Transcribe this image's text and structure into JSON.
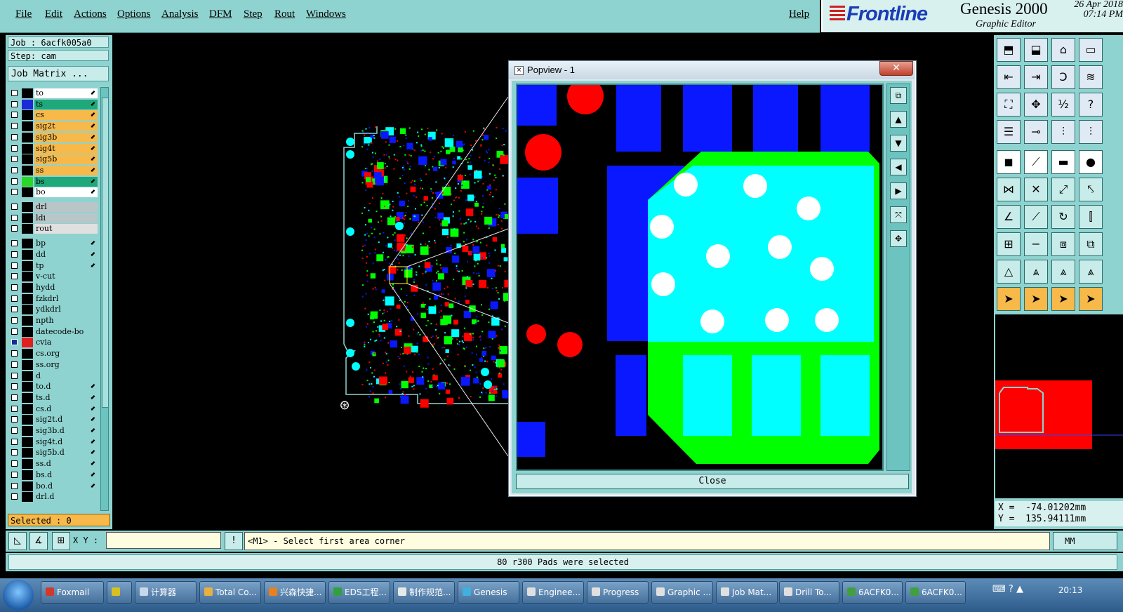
{
  "menu": {
    "items": [
      "File",
      "Edit",
      "Actions",
      "Options",
      "Analysis",
      "DFM",
      "Step",
      "Rout",
      "Windows"
    ],
    "help": "Help"
  },
  "brand": {
    "logo": "Frontline",
    "product": "Genesis 2000",
    "subtitle": "Graphic Editor",
    "date": "26 Apr 2018",
    "time": "07:14 PM"
  },
  "job": {
    "job_label": "Job : 6acfk005a0",
    "step_label": "Step: cam",
    "matrix_button": "Job Matrix ..."
  },
  "layers": [
    {
      "name": "to",
      "color": "#ffffff",
      "swatch": "#000000",
      "arrow": true
    },
    {
      "name": "ts",
      "color": "#1fa87a",
      "swatch": "#1a2ad8",
      "arrow": true
    },
    {
      "name": "cs",
      "color": "#f6b94a",
      "swatch": "#000000",
      "arrow": true
    },
    {
      "name": "sig2t",
      "color": "#f6b94a",
      "swatch": "#000000",
      "arrow": true
    },
    {
      "name": "sig3b",
      "color": "#f6b94a",
      "swatch": "#000000",
      "arrow": true
    },
    {
      "name": "sig4t",
      "color": "#f6b94a",
      "swatch": "#000000",
      "arrow": true
    },
    {
      "name": "sig5b",
      "color": "#f6b94a",
      "swatch": "#000000",
      "arrow": true
    },
    {
      "name": "ss",
      "color": "#f6b94a",
      "swatch": "#000000",
      "arrow": true
    },
    {
      "name": "bs",
      "color": "#1fa87a",
      "swatch": "#2ad82a",
      "arrow": true
    },
    {
      "name": "bo",
      "color": "#ffffff",
      "swatch": "#000000",
      "arrow": true
    },
    {
      "name": "drl",
      "color": "#b8c6c8",
      "swatch": "#000000",
      "arrow": false
    },
    {
      "name": "ldi",
      "color": "#b8c6c8",
      "swatch": "#000000",
      "arrow": false
    },
    {
      "name": "rout",
      "color": "#e0e0e0",
      "swatch": "#000000",
      "arrow": false
    },
    {
      "name": "bp",
      "color": "#8fd3d0",
      "swatch": "#000000",
      "arrow": true
    },
    {
      "name": "dd",
      "color": "#8fd3d0",
      "swatch": "#000000",
      "arrow": true
    },
    {
      "name": "tp",
      "color": "#8fd3d0",
      "swatch": "#000000",
      "arrow": true
    },
    {
      "name": "v-cut",
      "color": "#8fd3d0",
      "swatch": "#000000",
      "arrow": false
    },
    {
      "name": "hydd",
      "color": "#8fd3d0",
      "swatch": "#000000",
      "arrow": false
    },
    {
      "name": "fzkdrl",
      "color": "#8fd3d0",
      "swatch": "#000000",
      "arrow": false
    },
    {
      "name": "ydkdrl",
      "color": "#8fd3d0",
      "swatch": "#000000",
      "arrow": false
    },
    {
      "name": "npth",
      "color": "#8fd3d0",
      "swatch": "#000000",
      "arrow": false
    },
    {
      "name": "datecode-bo",
      "color": "#8fd3d0",
      "swatch": "#000000",
      "arrow": false
    },
    {
      "name": "cvia",
      "color": "#8fd3d0",
      "swatch": "#e02020",
      "arrow": false,
      "checked": true
    },
    {
      "name": "cs.org",
      "color": "#8fd3d0",
      "swatch": "#000000",
      "arrow": false
    },
    {
      "name": "ss.org",
      "color": "#8fd3d0",
      "swatch": "#000000",
      "arrow": false
    },
    {
      "name": "d",
      "color": "#8fd3d0",
      "swatch": "#000000",
      "arrow": false
    },
    {
      "name": "to.d",
      "color": "#8fd3d0",
      "swatch": "#000000",
      "arrow": true
    },
    {
      "name": "ts.d",
      "color": "#8fd3d0",
      "swatch": "#000000",
      "arrow": true
    },
    {
      "name": "cs.d",
      "color": "#8fd3d0",
      "swatch": "#000000",
      "arrow": true
    },
    {
      "name": "sig2t.d",
      "color": "#8fd3d0",
      "swatch": "#000000",
      "arrow": true
    },
    {
      "name": "sig3b.d",
      "color": "#8fd3d0",
      "swatch": "#000000",
      "arrow": true
    },
    {
      "name": "sig4t.d",
      "color": "#8fd3d0",
      "swatch": "#000000",
      "arrow": true
    },
    {
      "name": "sig5b.d",
      "color": "#8fd3d0",
      "swatch": "#000000",
      "arrow": true
    },
    {
      "name": "ss.d",
      "color": "#8fd3d0",
      "swatch": "#000000",
      "arrow": true
    },
    {
      "name": "bs.d",
      "color": "#8fd3d0",
      "swatch": "#000000",
      "arrow": true
    },
    {
      "name": "bo.d",
      "color": "#8fd3d0",
      "swatch": "#000000",
      "arrow": true
    },
    {
      "name": "drl.d",
      "color": "#8fd3d0",
      "swatch": "#000000",
      "arrow": false
    }
  ],
  "selected_label": "Selected : 0",
  "popview": {
    "title": "Popview - 1",
    "close_button": "Close"
  },
  "coords": {
    "x": "X =  -74.01202",
    "y": "Y =  135.94111",
    "unit_suffix": "mm"
  },
  "command": {
    "xy_label": "X Y :",
    "xy_value": "",
    "prompt": "<M1> - Select first area corner",
    "unit": "MM"
  },
  "status_message": "80 r300 Pads were selected",
  "colors": {
    "panel": "#8fd3d0",
    "pad_blue": "#0a18ff",
    "pad_red": "#ff0000",
    "pad_green": "#00ff00",
    "pad_cyan": "#00ffff",
    "selected_bg": "#f6b94a"
  },
  "taskbar": {
    "tasks": [
      {
        "label": "Foxmail",
        "icon": "#d03a2a"
      },
      {
        "label": "",
        "icon": "#d8c020"
      },
      {
        "label": "计算器",
        "icon": "#c8d8e8"
      },
      {
        "label": "Total Co...",
        "icon": "#e8b040"
      },
      {
        "label": "兴森快捷...",
        "icon": "#e88020"
      },
      {
        "label": "EDS工程...",
        "icon": "#30a040"
      },
      {
        "label": "制作规范...",
        "icon": "#e8e8e8"
      },
      {
        "label": "Genesis",
        "icon": "#40b0e0"
      },
      {
        "label": "Enginee...",
        "icon": "#e0e0e0"
      },
      {
        "label": "Progress",
        "icon": "#e0e0e0"
      },
      {
        "label": "Graphic ...",
        "icon": "#e0e0e0"
      },
      {
        "label": "Job Mat...",
        "icon": "#e0e0e0"
      },
      {
        "label": "Drill To...",
        "icon": "#e0e0e0"
      },
      {
        "label": "6ACFK0...",
        "icon": "#40a040"
      },
      {
        "label": "6ACFK0...",
        "icon": "#40a040"
      }
    ],
    "clock": "20:13"
  }
}
